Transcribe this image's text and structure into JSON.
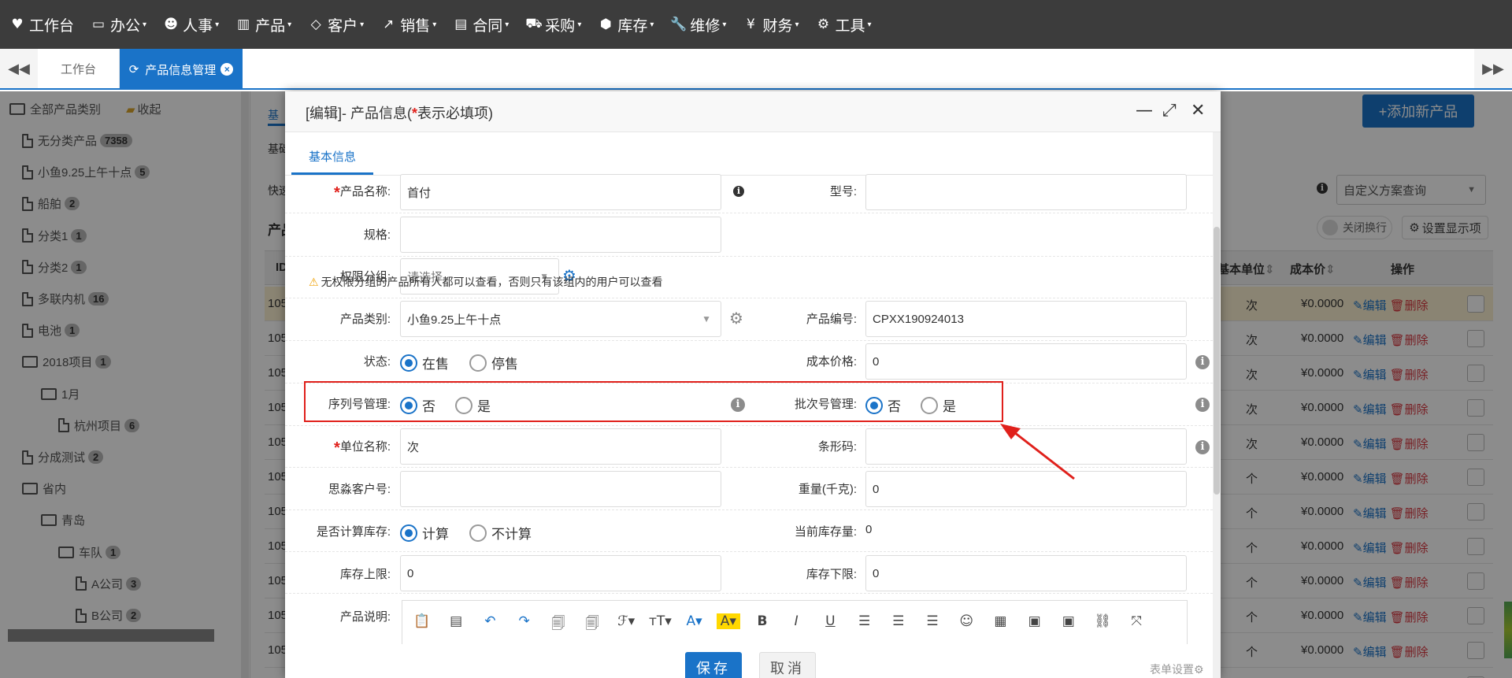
{
  "topnav": {
    "items": [
      {
        "label": "工作台",
        "icon": "heart-icon",
        "glyph": "♥",
        "caret": false
      },
      {
        "label": "办公",
        "icon": "laptop-icon",
        "glyph": "▭",
        "caret": true
      },
      {
        "label": "人事",
        "icon": "users-icon",
        "glyph": "☻",
        "caret": true
      },
      {
        "label": "产品",
        "icon": "barcode-icon",
        "glyph": "▥",
        "caret": true
      },
      {
        "label": "客户",
        "icon": "diamond-icon",
        "glyph": "◇",
        "caret": true
      },
      {
        "label": "销售",
        "icon": "line-chart-icon",
        "glyph": "↗",
        "caret": true
      },
      {
        "label": "合同",
        "icon": "newspaper-icon",
        "glyph": "▤",
        "caret": true
      },
      {
        "label": "采购",
        "icon": "cart-icon",
        "glyph": "⛟",
        "caret": true
      },
      {
        "label": "库存",
        "icon": "cubes-icon",
        "glyph": "⬢",
        "caret": true
      },
      {
        "label": "维修",
        "icon": "wrench-icon",
        "glyph": "🔧",
        "caret": true
      },
      {
        "label": "财务",
        "icon": "yen-icon",
        "glyph": "¥",
        "caret": true
      },
      {
        "label": "工具",
        "icon": "gear-icon",
        "glyph": "⚙",
        "caret": true
      }
    ],
    "caret_glyph": "▾"
  },
  "tabbar": {
    "prev_glyph": "◀◀",
    "next_glyph": "▶▶",
    "home_label": "工作台",
    "active_label": "产品信息管理",
    "active_icon_glyph": "⟳",
    "close_glyph": "×"
  },
  "tree": {
    "root_label": "全部产品类别",
    "collapse_label": "收起",
    "items": [
      {
        "label": "无分类产品",
        "count": "7358",
        "type": "file",
        "level": 1
      },
      {
        "label": "小鱼9.25上午十点",
        "count": "5",
        "type": "file",
        "level": 1
      },
      {
        "label": "船舶",
        "count": "2",
        "type": "file",
        "level": 1
      },
      {
        "label": "分类1",
        "count": "1",
        "type": "file",
        "level": 1
      },
      {
        "label": "分类2",
        "count": "1",
        "type": "file",
        "level": 1
      },
      {
        "label": "多联内机",
        "count": "16",
        "type": "file",
        "level": 1
      },
      {
        "label": "电池",
        "count": "1",
        "type": "file",
        "level": 1
      },
      {
        "label": "2018项目",
        "count": "1",
        "type": "folder",
        "level": 1
      },
      {
        "label": "1月",
        "count": "",
        "type": "folder",
        "level": 2
      },
      {
        "label": "杭州项目",
        "count": "6",
        "type": "file",
        "level": 3
      },
      {
        "label": "分成测试",
        "count": "2",
        "type": "file",
        "level": 1
      },
      {
        "label": "省内",
        "count": "",
        "type": "folder",
        "level": 1
      },
      {
        "label": "青岛",
        "count": "",
        "type": "folder",
        "level": 2
      },
      {
        "label": "车队",
        "count": "1",
        "type": "folder",
        "level": 3
      },
      {
        "label": "A公司",
        "count": "3",
        "type": "file",
        "level": 4
      },
      {
        "label": "B公司",
        "count": "2",
        "type": "file",
        "level": 4
      }
    ]
  },
  "main": {
    "add_button_label": "+添加新产品",
    "scheme_select": "自定义方案查询",
    "wrap_toggle_label": "关闭换行",
    "display_settings_label": "设置显示项",
    "partial_labels": {
      "tab": "基",
      "basic": "基础",
      "quick": "快速",
      "panel": "产品",
      "id_col": "ID"
    },
    "columns": {
      "unit": "基本单位",
      "cost": "成本价",
      "actions": "操作"
    },
    "sort_glyph": "⇕",
    "edit_label": "编辑",
    "delete_label": "删除",
    "edit_icon": "pencil-icon",
    "delete_icon": "trash-icon",
    "rows": [
      {
        "id": "105",
        "unit": "次",
        "cost": "¥0.0000",
        "highlight": true
      },
      {
        "id": "105",
        "unit": "次",
        "cost": "¥0.0000",
        "highlight": false
      },
      {
        "id": "105",
        "unit": "次",
        "cost": "¥0.0000",
        "highlight": false
      },
      {
        "id": "105",
        "unit": "次",
        "cost": "¥0.0000",
        "highlight": false
      },
      {
        "id": "105",
        "unit": "次",
        "cost": "¥0.0000",
        "highlight": false
      },
      {
        "id": "105",
        "unit": "个",
        "cost": "¥0.0000",
        "highlight": false
      },
      {
        "id": "105",
        "unit": "个",
        "cost": "¥0.0000",
        "highlight": false
      },
      {
        "id": "105",
        "unit": "个",
        "cost": "¥0.0000",
        "highlight": false
      },
      {
        "id": "105",
        "unit": "个",
        "cost": "¥0.0000",
        "highlight": false
      },
      {
        "id": "105",
        "unit": "个",
        "cost": "¥0.0000",
        "highlight": false
      },
      {
        "id": "105",
        "unit": "个",
        "cost": "¥0.0000",
        "highlight": false
      },
      {
        "id": "105",
        "unit": "个",
        "cost": "¥0.0000",
        "highlight": false
      }
    ]
  },
  "modal": {
    "title_prefix": "[编辑]- 产品信息(",
    "title_star": "*",
    "title_suffix": "表示必填项)",
    "minimize_glyph": "—",
    "maximize_glyph": "⤢",
    "close_glyph": "✕",
    "tab_label": "基本信息",
    "required_mark": "*",
    "fields": {
      "name_label": "产品名称:",
      "name_value": "首付",
      "model_label": "型号:",
      "model_value": "",
      "spec_label": "规格:",
      "spec_value": "",
      "perm_label": "权限分组:",
      "perm_placeholder": "请选择",
      "perm_warning": "无权限分组的产品所有人都可以查看，否则只有该组内的用户可以查看",
      "category_label": "产品类别:",
      "category_value": "小鱼9.25上午十点",
      "code_label": "产品编号:",
      "code_value": "CPXX190924013",
      "status_label": "状态:",
      "status_on": "在售",
      "status_off": "停售",
      "cost_label": "成本价格:",
      "cost_value": "0",
      "serial_label": "序列号管理:",
      "serial_no": "否",
      "serial_yes": "是",
      "batch_label": "批次号管理:",
      "batch_no": "否",
      "batch_yes": "是",
      "unit_label": "单位名称:",
      "unit_value": "次",
      "barcode_label": "条形码:",
      "barcode_value": "",
      "cust_label": "思淼客户号:",
      "cust_value": "",
      "weight_label": "重量(千克):",
      "weight_value": "0",
      "stockcalc_label": "是否计算库存:",
      "stockcalc_on": "计算",
      "stockcalc_off": "不计算",
      "curstock_label": "当前库存量:",
      "curstock_value": "0",
      "upper_label": "库存上限:",
      "upper_value": "0",
      "lower_label": "库存下限:",
      "lower_value": "0",
      "desc_label": "产品说明:"
    },
    "editor_tools": [
      {
        "glyph": "📋",
        "name": "paste-icon"
      },
      {
        "glyph": "▤",
        "name": "paste-text-icon"
      },
      {
        "glyph": "↶",
        "name": "undo-icon"
      },
      {
        "glyph": "↷",
        "name": "redo-icon"
      },
      {
        "glyph": "🗐",
        "name": "paste-word-icon"
      },
      {
        "glyph": "🗐",
        "name": "paste-plain-icon"
      },
      {
        "glyph": "ℱ▾",
        "name": "font-family-icon"
      },
      {
        "glyph": "тT▾",
        "name": "font-size-icon"
      },
      {
        "glyph": "A▾",
        "name": "font-color-icon"
      },
      {
        "glyph": "A▾",
        "name": "background-color-icon"
      },
      {
        "glyph": "B",
        "name": "bold-icon"
      },
      {
        "glyph": "I",
        "name": "italic-icon"
      },
      {
        "glyph": "U",
        "name": "underline-icon"
      },
      {
        "glyph": "☰",
        "name": "align-left-icon"
      },
      {
        "glyph": "☰",
        "name": "align-center-icon"
      },
      {
        "glyph": "☰",
        "name": "align-right-icon"
      },
      {
        "glyph": "☺",
        "name": "emoticon-icon"
      },
      {
        "glyph": "▦",
        "name": "table-icon"
      },
      {
        "glyph": "▣",
        "name": "insert-image-icon"
      },
      {
        "glyph": "▣",
        "name": "multi-image-icon"
      },
      {
        "glyph": "⛓",
        "name": "link-icon"
      },
      {
        "glyph": "⤧",
        "name": "fullscreen-icon"
      }
    ],
    "save_label": "保存",
    "cancel_label": "取消",
    "form_settings_label": "表单设置",
    "form_settings_glyph": "⚙",
    "info_glyph": "i",
    "gear_glyph": "⚙",
    "caret_glyph": "▼",
    "warn_glyph": "⚠"
  },
  "colors": {
    "accent": "#1a73c8",
    "nav_bg": "#3c3c3c",
    "annotation_red": "#e0201b",
    "row_highlight": "#fcf1d2",
    "delete_red": "#d9363e"
  }
}
